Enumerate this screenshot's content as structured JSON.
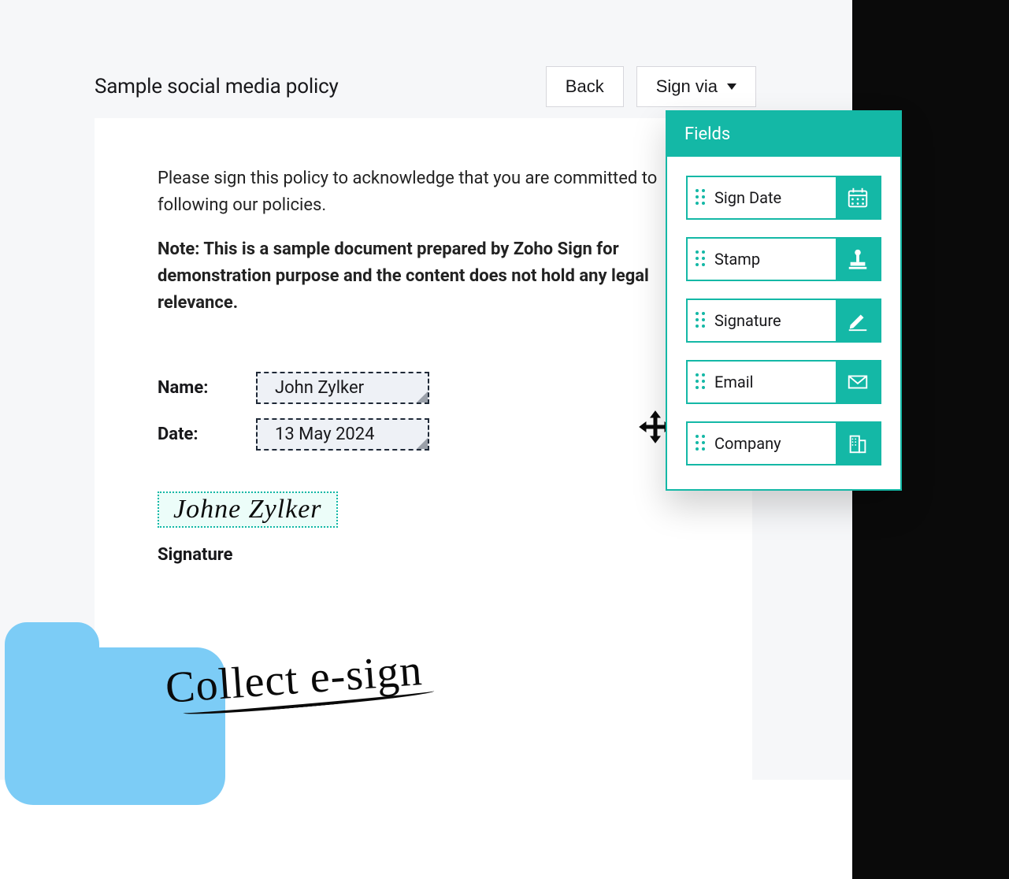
{
  "header": {
    "title": "Sample social media policy",
    "back_label": "Back",
    "signvia_label": "Sign via"
  },
  "document": {
    "intro": "Please sign this policy to acknowledge that you are committed to following our policies.",
    "note": "Note: This is a sample document prepared by Zoho Sign for demonstration purpose and the content does not hold any legal relevance.",
    "name_label": "Name:",
    "name_value": "John Zylker",
    "date_label": "Date:",
    "date_value": "13 May 2024",
    "signature_script": "Johne Zylker",
    "signature_label": "Signature"
  },
  "fields_panel": {
    "title": "Fields",
    "items": [
      {
        "label": "Sign Date",
        "icon": "calendar-icon"
      },
      {
        "label": "Stamp",
        "icon": "stamp-icon"
      },
      {
        "label": "Signature",
        "icon": "pen-icon"
      },
      {
        "label": "Email",
        "icon": "envelope-icon"
      },
      {
        "label": "Company",
        "icon": "building-icon"
      }
    ]
  },
  "annotation": "Collect e-sign"
}
